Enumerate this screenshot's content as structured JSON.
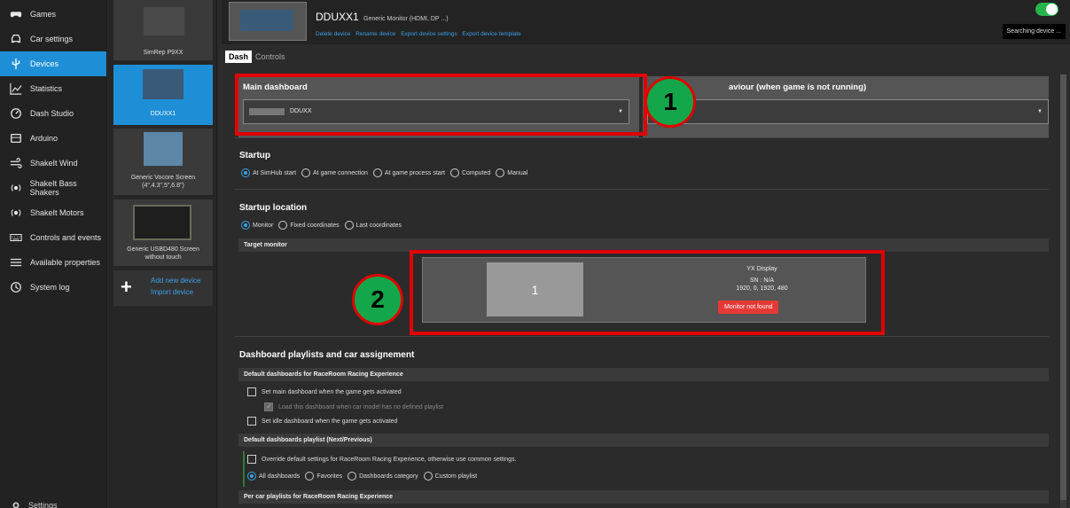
{
  "sidebar": {
    "items": [
      {
        "label": "Games",
        "icon": "gamepad-icon"
      },
      {
        "label": "Car settings",
        "icon": "car-icon"
      },
      {
        "label": "Devices",
        "icon": "usb-icon",
        "active": true
      },
      {
        "label": "Statistics",
        "icon": "chart-icon"
      },
      {
        "label": "Dash Studio",
        "icon": "dash-studio-icon"
      },
      {
        "label": "Arduino",
        "icon": "arduino-icon"
      },
      {
        "label": "ShakeIt Wind",
        "icon": "wind-icon"
      },
      {
        "label": "ShakeIt Bass Shakers",
        "icon": "bass-shaker-icon"
      },
      {
        "label": "ShakeIt Motors",
        "icon": "motor-icon"
      },
      {
        "label": "Controls and events",
        "icon": "keyboard-icon"
      },
      {
        "label": "Available properties",
        "icon": "list-icon"
      },
      {
        "label": "System log",
        "icon": "history-icon"
      }
    ],
    "settings_label": "Settings"
  },
  "devices": {
    "cards": [
      {
        "label": "SimRep P9XX"
      },
      {
        "label": "DDUXX1",
        "active": true
      },
      {
        "label": "Generic Vocore Screen (4\",4.3\",5\",6.8\")"
      },
      {
        "label": "Generic USBD480 Screen without touch"
      }
    ],
    "add_new": "Add new device",
    "import": "Import device"
  },
  "header": {
    "device_name": "DDUXX1",
    "device_type": "Generic Monitor (HDMI, DP ...)",
    "links": [
      "Delete device",
      "Rename device",
      "Export device settings",
      "Export device template"
    ],
    "status": "Searching device ..."
  },
  "tabs": [
    "Dash",
    "Controls"
  ],
  "main_dashboard": {
    "title": "Main dashboard",
    "selected": "DDUXX",
    "idle_title_fragment": "aviour (when game is not running)"
  },
  "startup": {
    "title": "Startup",
    "options": [
      "At SimHub start",
      "At game connection",
      "At game process start",
      "Computed",
      "Manual"
    ],
    "selected_index": 0
  },
  "startup_location": {
    "title": "Startup location",
    "options": [
      "Monitor",
      "Fixed coordinates",
      "Last coordinates"
    ],
    "selected_index": 0,
    "target_monitor_label": "Target monitor",
    "monitor_number": "1",
    "monitor_name": "YX Display",
    "monitor_sn": "SN : N/A",
    "monitor_geometry": "1920, 0, 1920, 480",
    "monitor_status": "Monitor not found"
  },
  "playlists": {
    "title": "Dashboard playlists and car assignement",
    "default_header": "Default dashboards for RaceRoom Racing Experience",
    "check_main": "Set main dashboard when the game gets activated",
    "check_load": "Load this dashboard when car model has no defined playlist",
    "check_idle": "Set idle dashboard when the game gets activated",
    "nextprev_header": "Default dashboards playlist (Next/Previous)",
    "override": "Override default settings for RaceRoom Racing Experience, otherwise use common settings.",
    "playlist_options": [
      "All dashboards",
      "Favorites",
      "Dashboards category",
      "Custom playlist"
    ],
    "playlist_selected_index": 0,
    "percar_header": "Per car playlists for RaceRoom Racing Experience"
  },
  "annotations": {
    "badge1": "1",
    "badge2": "2"
  },
  "colors": {
    "accent": "#1e8fd6",
    "link": "#3ea0e6",
    "annotation_red": "#e00000",
    "annotation_green": "#14a64a",
    "toggle_on": "#25b44a",
    "error": "#e53935"
  }
}
